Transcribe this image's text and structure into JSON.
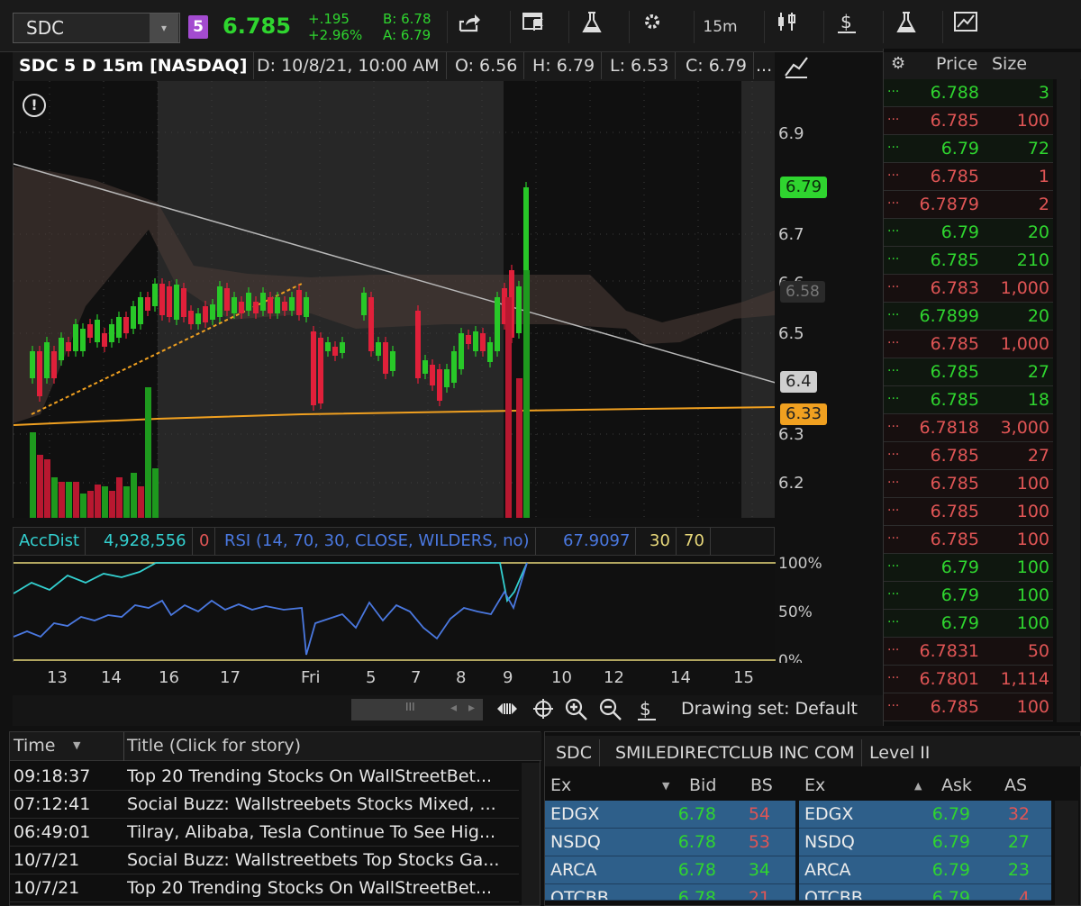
{
  "toolbar": {
    "symbol": "SDC",
    "symbol_dropdown": "▾",
    "link_badge": "5",
    "last_price": "6.785",
    "change": "+.195",
    "change_pct": "+2.96%",
    "bid": "B: 6.78",
    "ask": "A: 6.79",
    "timeframe": "15m",
    "icons": [
      "share-icon",
      "flag-calendar-icon",
      "flask-icon",
      "gear-icon",
      "timeframe-button",
      "candle-style-icon",
      "dollar-icon",
      "flask-icon-2",
      "drawings-icon"
    ],
    "colors": {
      "up": "#2fd52f",
      "badge": "#a34bd0"
    }
  },
  "chart_header": {
    "title": "SDC 5 D 15m [NASDAQ]",
    "date": "D: 10/8/21, 10:00 AM",
    "open": "O: 6.56",
    "high": "H: 6.79",
    "low": "L: 6.53",
    "close": "C: 6.79",
    "more": "..."
  },
  "price_axis": {
    "ticks": [
      "6.9",
      "6.7",
      "6.6",
      "6.5",
      "6.3",
      "6.2"
    ],
    "tag_last": "6.79",
    "tag_trend": "6.4",
    "tag_avg": "6.33",
    "tag_cloud": "6.58"
  },
  "study_header": {
    "accdist_label": "AccDist",
    "accdist_value": "4,928,556",
    "accdist_zero": "0",
    "rsi_label": "RSI (14, 70, 30, CLOSE, WILDERS, no)",
    "rsi_value": "67.9097",
    "rsi_low": "30",
    "rsi_high": "70",
    "axis": [
      "100%",
      "50%",
      "0%"
    ]
  },
  "time_axis": {
    "labels": [
      "13",
      "14",
      "16",
      "17",
      "Fri",
      "5",
      "7",
      "8",
      "9",
      "10",
      "12",
      "14",
      "15"
    ]
  },
  "bottom_bar": {
    "drawing_set": "Drawing set: Default",
    "scroll_grip": "III"
  },
  "time_sales": {
    "headers": {
      "price": "Price",
      "size": "Size"
    },
    "rows": [
      {
        "dot": "...",
        "price": "6.788",
        "size": "3",
        "side": "up"
      },
      {
        "dot": "...",
        "price": "6.785",
        "size": "100",
        "side": "down"
      },
      {
        "dot": "...",
        "price": "6.79",
        "size": "72",
        "side": "up"
      },
      {
        "dot": "...",
        "price": "6.785",
        "size": "1",
        "side": "down"
      },
      {
        "dot": "...",
        "price": "6.7879",
        "size": "2",
        "side": "down"
      },
      {
        "dot": "...",
        "price": "6.79",
        "size": "20",
        "side": "up"
      },
      {
        "dot": "...",
        "price": "6.785",
        "size": "210",
        "side": "up"
      },
      {
        "dot": "...",
        "price": "6.783",
        "size": "1,000",
        "side": "down"
      },
      {
        "dot": "...",
        "price": "6.7899",
        "size": "20",
        "side": "up"
      },
      {
        "dot": "...",
        "price": "6.785",
        "size": "1,000",
        "side": "down"
      },
      {
        "dot": "...",
        "price": "6.785",
        "size": "27",
        "side": "up"
      },
      {
        "dot": "...",
        "price": "6.785",
        "size": "18",
        "side": "up"
      },
      {
        "dot": "...",
        "price": "6.7818",
        "size": "3,000",
        "side": "down"
      },
      {
        "dot": "...",
        "price": "6.785",
        "size": "27",
        "side": "down"
      },
      {
        "dot": "...",
        "price": "6.785",
        "size": "100",
        "side": "down"
      },
      {
        "dot": "...",
        "price": "6.785",
        "size": "100",
        "side": "down"
      },
      {
        "dot": "...",
        "price": "6.785",
        "size": "100",
        "side": "down"
      },
      {
        "dot": "...",
        "price": "6.79",
        "size": "100",
        "side": "up"
      },
      {
        "dot": "...",
        "price": "6.79",
        "size": "100",
        "side": "up"
      },
      {
        "dot": "...",
        "price": "6.79",
        "size": "100",
        "side": "up"
      },
      {
        "dot": "...",
        "price": "6.7831",
        "size": "50",
        "side": "down"
      },
      {
        "dot": "...",
        "price": "6.7801",
        "size": "1,114",
        "side": "down"
      },
      {
        "dot": "...",
        "price": "6.785",
        "size": "100",
        "side": "down"
      }
    ]
  },
  "news": {
    "headers": {
      "time": "Time",
      "title": "Title (Click for story)"
    },
    "rows": [
      {
        "time": "09:18:37",
        "title": "Top 20 Trending Stocks On WallStreetBet..."
      },
      {
        "time": "07:12:41",
        "title": "Social Buzz: Wallstreebets Stocks Mixed, ..."
      },
      {
        "time": "06:49:01",
        "title": "Tilray, Alibaba, Tesla Continue To See Hig..."
      },
      {
        "time": "10/7/21",
        "title": "Social Buzz: Wallstreetbets Top Stocks Ga..."
      },
      {
        "time": "10/7/21",
        "title": "Top 20 Trending Stocks On WallStreetBet..."
      }
    ]
  },
  "level2": {
    "symbol": "SDC",
    "name": "SMILEDIRECTCLUB INC COM",
    "tab": "Level II",
    "bid_headers": {
      "ex": "Ex",
      "px": "Bid",
      "sz": "BS"
    },
    "ask_headers": {
      "ex": "Ex",
      "px": "Ask",
      "sz": "AS"
    },
    "bids": [
      {
        "ex": "EDGX",
        "px": "6.78",
        "sz": "54",
        "szc": "#e05555"
      },
      {
        "ex": "NSDQ",
        "px": "6.78",
        "sz": "53",
        "szc": "#e05555"
      },
      {
        "ex": "ARCA",
        "px": "6.78",
        "sz": "34",
        "szc": "#2fd52f"
      },
      {
        "ex": "OTCBB",
        "px": "6.78",
        "sz": "21",
        "szc": "#e05555"
      }
    ],
    "asks": [
      {
        "ex": "EDGX",
        "px": "6.79",
        "sz": "32",
        "szc": "#e05555"
      },
      {
        "ex": "NSDQ",
        "px": "6.79",
        "sz": "27",
        "szc": "#2fd52f"
      },
      {
        "ex": "ARCA",
        "px": "6.79",
        "sz": "23",
        "szc": "#2fd52f"
      },
      {
        "ex": "OTCBB",
        "px": "6.79",
        "sz": "4",
        "szc": "#e05555"
      }
    ]
  }
}
